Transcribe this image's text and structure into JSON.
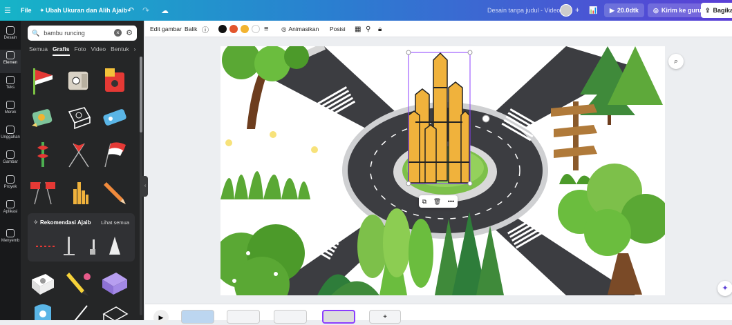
{
  "topbar": {
    "menu_icon": "hamburger-icon",
    "file_label": "File",
    "resize_label": "Ubah Ukuran dan Alih Ajaib",
    "doc_title": "Desain tanpa judul - Video",
    "duration": "20.0dtk",
    "teacher_button": "Kirim ke guru",
    "share_button": "Bagikan"
  },
  "rail": {
    "items": [
      "Desain",
      "Elemen",
      "Teks",
      "Merek",
      "Unggahan",
      "Gambar",
      "Proyek",
      "Aplikasi",
      "Menyemb"
    ]
  },
  "panel": {
    "search_value": "bambu runcing",
    "tabs": [
      "Semua",
      "Grafis",
      "Foto",
      "Video",
      "Bentuk"
    ],
    "active_tab": "Grafis",
    "reko_title": "Rekomendasi Ajaib",
    "reko_all": "Lihat semua"
  },
  "toolbar": {
    "edit_image": "Edit gambar",
    "flip": "Balik",
    "animate": "Animasikan",
    "position": "Posisi",
    "colors": [
      "#111111",
      "#e2552c",
      "#f2b330",
      "#ffffff"
    ]
  },
  "canvas": {
    "bg_color": "#ffffff",
    "road_color": "#3c3d41",
    "grass_color": "#7dc04a",
    "monument_color": "#f0b23c"
  }
}
